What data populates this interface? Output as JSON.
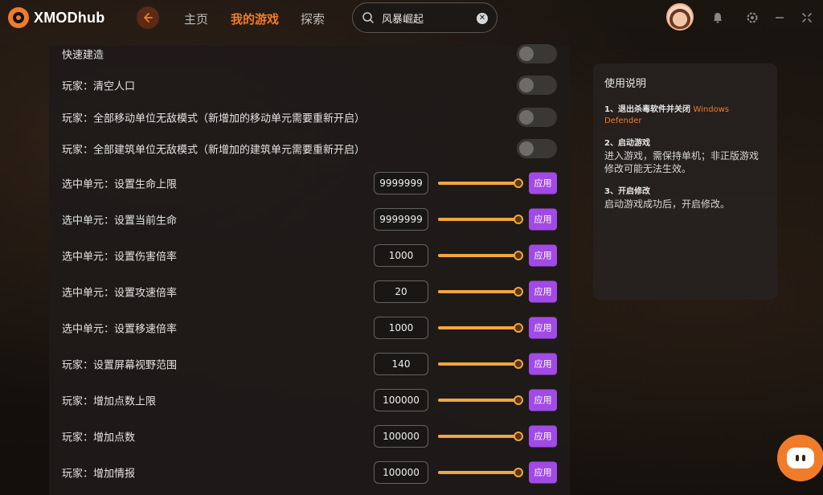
{
  "app": {
    "name": "XMODhub"
  },
  "nav": {
    "home": "主页",
    "my_games": "我的游戏",
    "explore": "探索"
  },
  "search": {
    "value": "风暴崛起"
  },
  "toggle_rows": [
    {
      "label": "快速建造",
      "on": false
    },
    {
      "label": "玩家：清空人口",
      "on": false
    },
    {
      "label": "玩家：全部移动单位无敌模式（新增加的移动单元需要重新开启）",
      "on": false
    },
    {
      "label": "玩家：全部建筑单位无敌模式（新增加的建筑单元需要重新开启）",
      "on": false
    }
  ],
  "value_rows": [
    {
      "label": "选中单元：设置生命上限",
      "value": "9999999",
      "level": 1.0,
      "apply": "应用"
    },
    {
      "label": "选中单元：设置当前生命",
      "value": "9999999",
      "level": 1.0,
      "apply": "应用"
    },
    {
      "label": "选中单元：设置伤害倍率",
      "value": "1000",
      "level": 1.0,
      "apply": "应用"
    },
    {
      "label": "选中单元：设置攻速倍率",
      "value": "20",
      "level": 1.0,
      "apply": "应用"
    },
    {
      "label": "选中单元：设置移速倍率",
      "value": "1000",
      "level": 1.0,
      "apply": "应用"
    },
    {
      "label": "玩家：设置屏幕视野范围",
      "value": "140",
      "level": 1.0,
      "apply": "应用"
    },
    {
      "label": "玩家：增加点数上限",
      "value": "100000",
      "level": 1.0,
      "apply": "应用"
    },
    {
      "label": "玩家：增加点数",
      "value": "100000",
      "level": 1.0,
      "apply": "应用"
    },
    {
      "label": "玩家：增加情报",
      "value": "100000",
      "level": 1.0,
      "apply": "应用"
    }
  ],
  "help": {
    "title": "使用说明",
    "steps": [
      {
        "heading": "1、退出杀毒软件并关闭",
        "highlight": "Windows Defender",
        "desc": ""
      },
      {
        "heading": "2、启动游戏",
        "highlight": "",
        "desc": "进入游戏，需保持单机；非正版游戏修改可能无法生效。"
      },
      {
        "heading": "3、开启修改",
        "highlight": "",
        "desc": "启动游戏成功后，开启修改。"
      }
    ]
  },
  "colors": {
    "accent": "#f07c2a",
    "apply": "#a14ae6",
    "slider": "#f0a640"
  },
  "icons": [
    "logo-icon",
    "back-arrow-icon",
    "search-icon",
    "clear-icon",
    "avatar",
    "notification-icon",
    "settings-icon",
    "minimize-icon",
    "close-icon",
    "chat-icon"
  ]
}
